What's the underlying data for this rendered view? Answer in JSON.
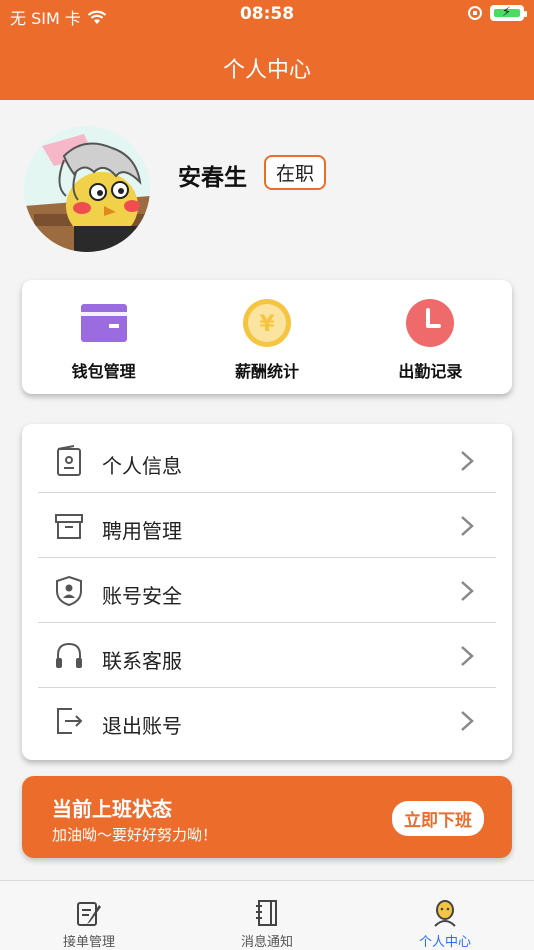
{
  "status_bar": {
    "carrier": "无 SIM 卡",
    "time": "08:58"
  },
  "header": {
    "title": "个人中心"
  },
  "profile": {
    "name": "安春生",
    "status_badge": "在职"
  },
  "quick_actions": [
    {
      "label": "钱包管理",
      "icon": "wallet-icon",
      "color": "#9b6be0"
    },
    {
      "label": "薪酬统计",
      "icon": "yen-coin-icon",
      "color": "#f5c542"
    },
    {
      "label": "出勤记录",
      "icon": "clock-icon",
      "color": "#ef6b6b"
    }
  ],
  "menu": [
    {
      "label": "个人信息",
      "icon": "id-card-icon"
    },
    {
      "label": "聘用管理",
      "icon": "archive-box-icon"
    },
    {
      "label": "账号安全",
      "icon": "shield-user-icon"
    },
    {
      "label": "联系客服",
      "icon": "headphones-icon"
    },
    {
      "label": "退出账号",
      "icon": "logout-icon"
    }
  ],
  "work_status": {
    "title": "当前上班状态",
    "subtitle": "加油呦～要好好努力呦！",
    "button": "立即下班"
  },
  "tabbar": [
    {
      "label": "接单管理",
      "icon": "clipboard-pen-icon",
      "active": false
    },
    {
      "label": "消息通知",
      "icon": "notebook-icon",
      "active": false
    },
    {
      "label": "个人中心",
      "icon": "user-icon",
      "active": true
    }
  ],
  "colors": {
    "accent": "#ec6c2c",
    "active_tab": "#2b6ef0"
  }
}
